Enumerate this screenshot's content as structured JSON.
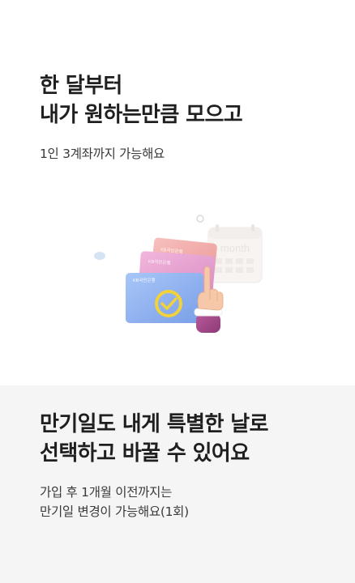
{
  "section1": {
    "title_line1": "한 달부터",
    "title_line2": "내가 원하는만큼 모으고",
    "description": "1인 3계좌까지 가능해요",
    "card_labels": [
      "KB국민은행",
      "KB국민은행",
      "KB국민은행"
    ],
    "calendar_label": "month"
  },
  "section2": {
    "title_line1": "만기일도 내게 특별한 날로",
    "title_line2": "선택하고 바꿀 수 있어요",
    "description_line1": "가입 후 1개월 이전까지는",
    "description_line2": "만기일 변경이 가능해요(1회)"
  },
  "colors": {
    "background_top": "#ffffff",
    "background_bottom": "#f5f5f5",
    "title": "#1f1f1f",
    "body_text": "#3a3a3a",
    "card_blue": "#8fb4f0",
    "card_pink": "#e7a3cf",
    "card_coral": "#f1a9a7",
    "check_badge": "#f2d23a"
  }
}
